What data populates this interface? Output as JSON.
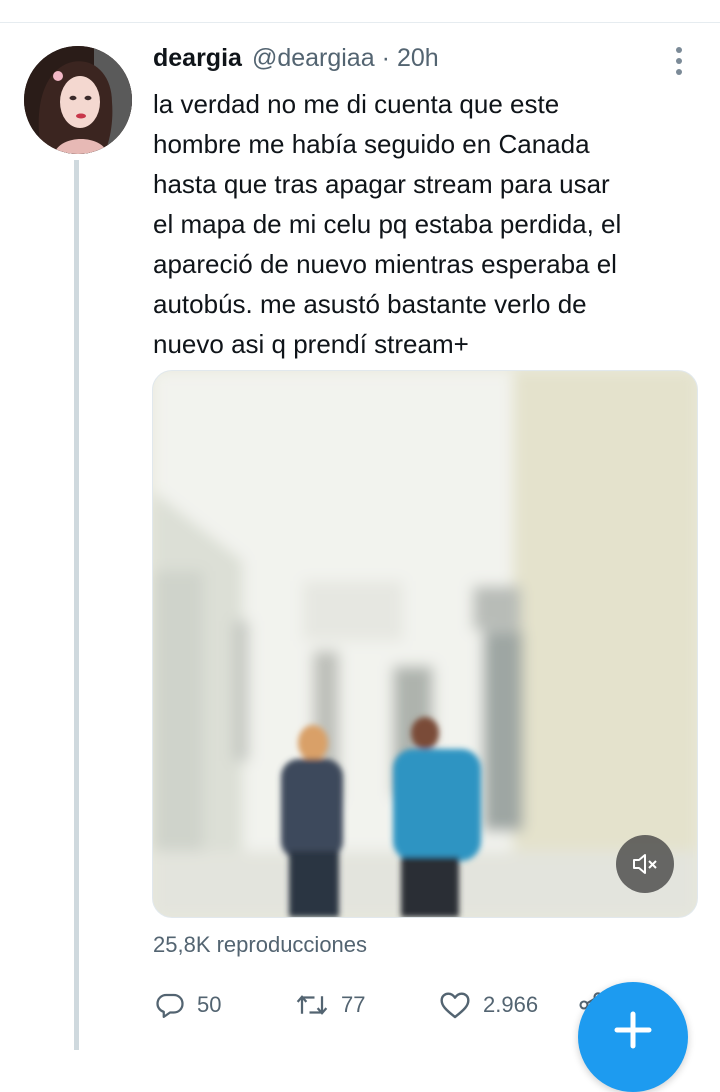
{
  "tweet": {
    "author_name": "deargia",
    "handle": "@deargiaa",
    "separator": "·",
    "time": "20h",
    "text": "la verdad no me di cuenta que este\nhombre me había seguido en Canada\nhasta que tras apagar stream para usar\nel mapa de mi celu pq estaba perdida, el\napareció de nuevo mientras esperaba el\nautobús. me asustó bastante verlo de\nnuevo asi q prendí stream+",
    "views": "25,8K reproducciones",
    "reply_count": "50",
    "retweet_count": "77",
    "like_count": "2.966"
  },
  "icons": {
    "more": "more-vertical-icon",
    "mute": "volume-muted-icon",
    "reply": "reply-icon",
    "retweet": "retweet-icon",
    "like": "heart-icon",
    "share": "share-icon",
    "compose": "plus-icon"
  },
  "colors": {
    "accent": "#1d9bf0",
    "secondary_text": "#536471",
    "thread_line": "#cfd9de"
  }
}
